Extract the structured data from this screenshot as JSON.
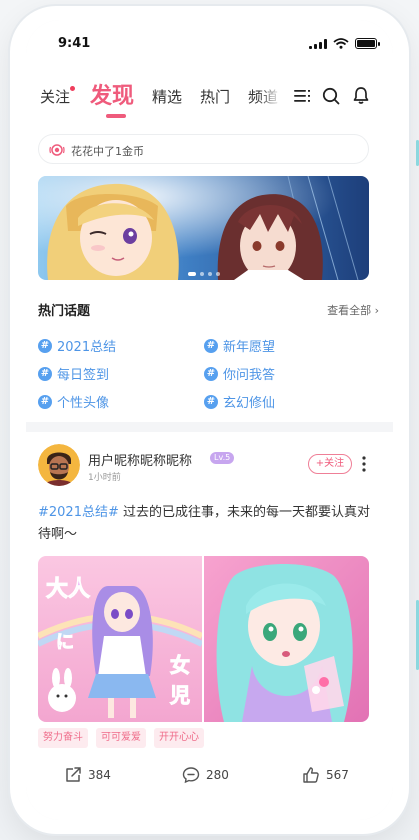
{
  "status_bar": {
    "time": "9:41"
  },
  "tabs": [
    {
      "label": "关注",
      "active": false,
      "has_dot": true
    },
    {
      "label": "发现",
      "active": true,
      "has_dot": false
    },
    {
      "label": "精选",
      "active": false,
      "has_dot": false
    },
    {
      "label": "热门",
      "active": false,
      "has_dot": false
    },
    {
      "label": "频道",
      "active": false,
      "has_dot": false
    }
  ],
  "header_icons": [
    "menu-icon",
    "search-icon",
    "bell-icon"
  ],
  "notice": {
    "text": "花花中了1金币",
    "icon": "coin-broadcast-icon"
  },
  "banner": {
    "active_index": 0,
    "dot_count": 4
  },
  "hot_topics": {
    "title": "热门话题",
    "see_all": "查看全部 ›",
    "items": [
      "2021总结",
      "新年愿望",
      "每日签到",
      "你问我答",
      "个性头像",
      "玄幻修仙"
    ]
  },
  "post": {
    "username": "用户昵称昵称昵称",
    "level": "Lv.5",
    "time": "1小时前",
    "follow_label": "+关注",
    "hashtag": "#2021总结#",
    "text": " 过去的已成往事，未来的每一天都要认真对待啊～",
    "tags": [
      "努力奋斗",
      "可可爱爱",
      "开开心心"
    ],
    "actions": {
      "share_count": "384",
      "comment_count": "280",
      "like_count": "567"
    }
  },
  "colors": {
    "accent": "#ef5b7c",
    "link": "#4e95e6",
    "background": "#f4f5f7"
  }
}
